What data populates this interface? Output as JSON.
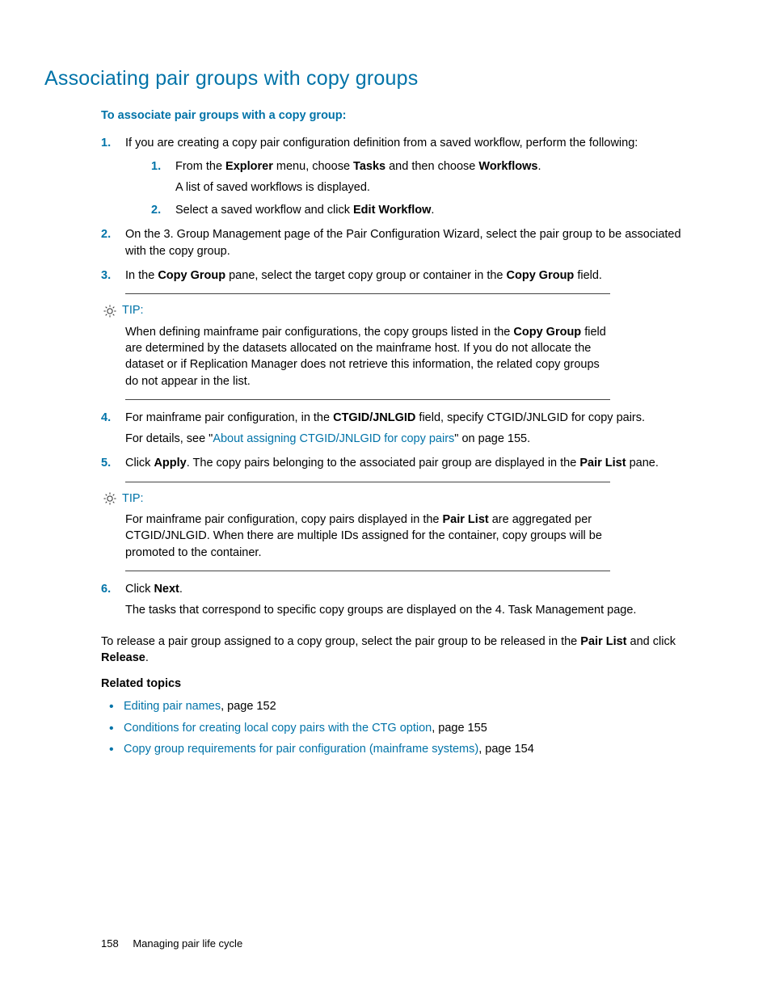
{
  "title": "Associating pair groups with copy groups",
  "intro": "To associate pair groups with a copy group:",
  "steps": {
    "s1": {
      "text_a": "If you are creating a copy pair configuration definition from a saved workflow, perform the following:",
      "sub1_a": "From the ",
      "sub1_b": "Explorer",
      "sub1_c": " menu, choose ",
      "sub1_d": "Tasks",
      "sub1_e": " and then choose ",
      "sub1_f": "Workflows",
      "sub1_g": ".",
      "sub1_follow": "A list of saved workflows is displayed.",
      "sub2_a": "Select a saved workflow and click ",
      "sub2_b": "Edit Workflow",
      "sub2_c": "."
    },
    "s2": "On the 3. Group Management page of the Pair Configuration Wizard, select the pair group to be associated with the copy group.",
    "s3_a": "In the ",
    "s3_b": "Copy Group",
    "s3_c": " pane, select the target copy group or container in the ",
    "s3_d": "Copy Group",
    "s3_e": " field.",
    "s4_a": "For mainframe pair configuration, in the ",
    "s4_b": "CTGID/JNLGID",
    "s4_c": " field, specify CTGID/JNLGID for copy pairs.",
    "s4_follow_a": "For details, see \"",
    "s4_follow_link": "About assigning CTGID/JNLGID for copy pairs",
    "s4_follow_b": "\" on page 155.",
    "s5_a": "Click ",
    "s5_b": "Apply",
    "s5_c": ". The copy pairs belonging to the associated pair group are displayed in the ",
    "s5_d": "Pair List",
    "s5_e": " pane.",
    "s6_a": "Click ",
    "s6_b": "Next",
    "s6_c": ".",
    "s6_follow": "The tasks that correspond to specific copy groups are displayed on the 4. Task Management page."
  },
  "tip1": {
    "label": "TIP:",
    "body_a": "When defining mainframe pair configurations, the copy groups listed in the ",
    "body_b": "Copy Group",
    "body_c": " field are determined by the datasets allocated on the mainframe host. If you do not allocate the dataset or if Replication Manager does not retrieve this information, the related copy groups do not appear in the list."
  },
  "tip2": {
    "label": "TIP:",
    "body_a": "For mainframe pair configuration, copy pairs displayed in the ",
    "body_b": "Pair List",
    "body_c": " are aggregated per CTGID/JNLGID. When there are multiple IDs assigned for the container, copy groups will be promoted to the container."
  },
  "release_a": "To release a pair group assigned to a copy group, select the pair group to be released in the ",
  "release_b": "Pair List",
  "release_c": " and click ",
  "release_d": "Release",
  "release_e": ".",
  "related_head": "Related topics",
  "related": [
    {
      "link": "Editing pair names",
      "rest": ", page 152"
    },
    {
      "link": "Conditions for creating local copy pairs with the CTG option",
      "rest": ", page 155"
    },
    {
      "link": "Copy group requirements for pair configuration (mainframe systems)",
      "rest": ", page 154"
    }
  ],
  "footer": {
    "page": "158",
    "chapter": "Managing pair life cycle"
  }
}
